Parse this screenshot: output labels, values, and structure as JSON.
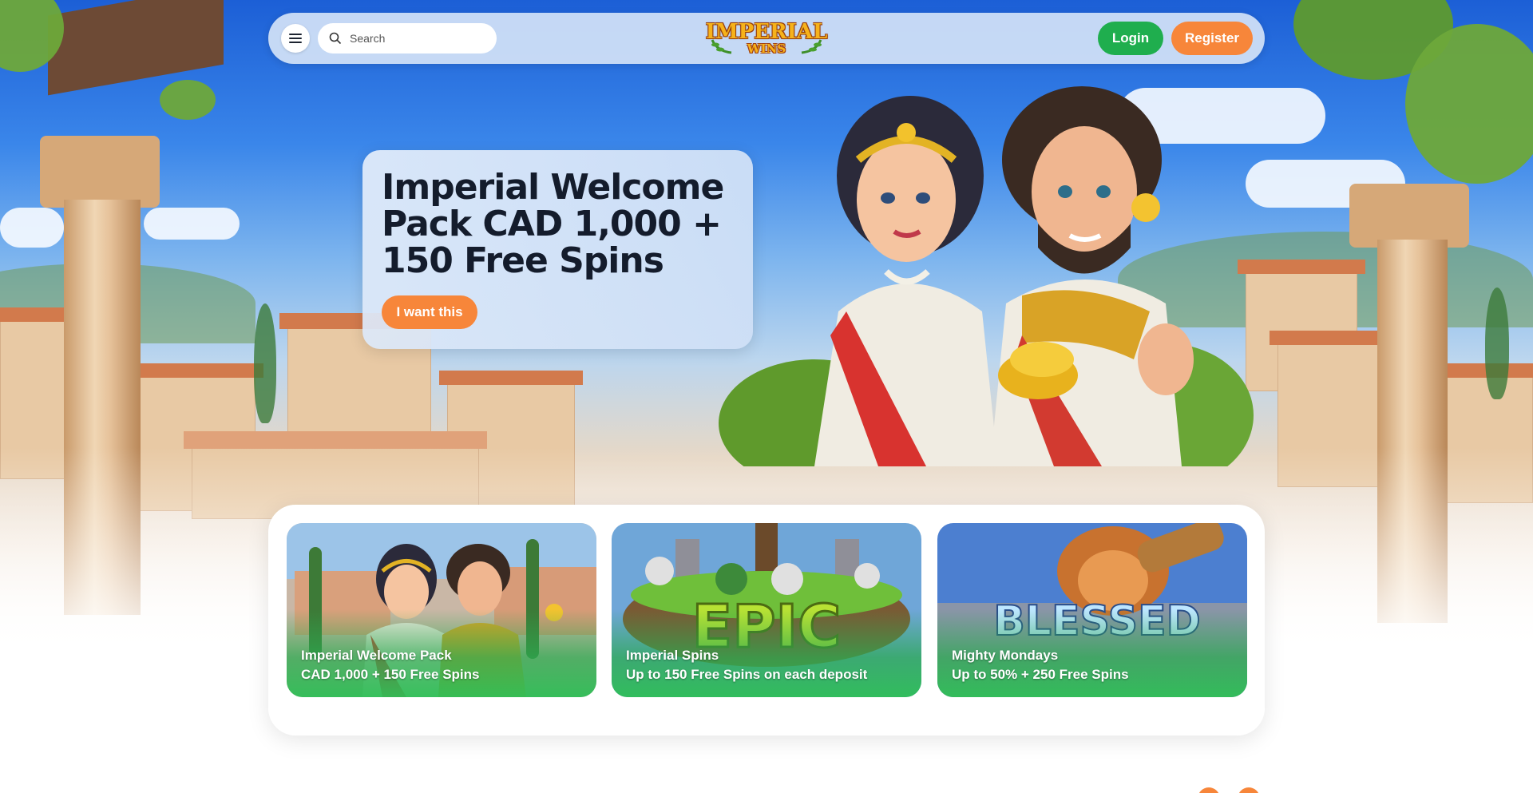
{
  "header": {
    "search_placeholder": "Search",
    "logo_line1": "IMPERIAL",
    "logo_line2": "WINS",
    "login_label": "Login",
    "register_label": "Register"
  },
  "hero": {
    "title": "Imperial Welcome Pack CAD 1,000 + 150 Free Spins",
    "cta_label": "I want this"
  },
  "promotions": [
    {
      "title": "Imperial Welcome Pack",
      "subtitle": "CAD 1,000 + 150 Free Spins"
    },
    {
      "title": "Imperial Spins",
      "subtitle": "Up to 150 Free Spins on each deposit"
    },
    {
      "title": "Mighty Mondays",
      "subtitle": "Up to 50% + 250 Free Spins"
    }
  ],
  "colors": {
    "accent_orange": "#f7863a",
    "login_green": "#1fae4e",
    "sky_blue": "#1c5fd6"
  }
}
